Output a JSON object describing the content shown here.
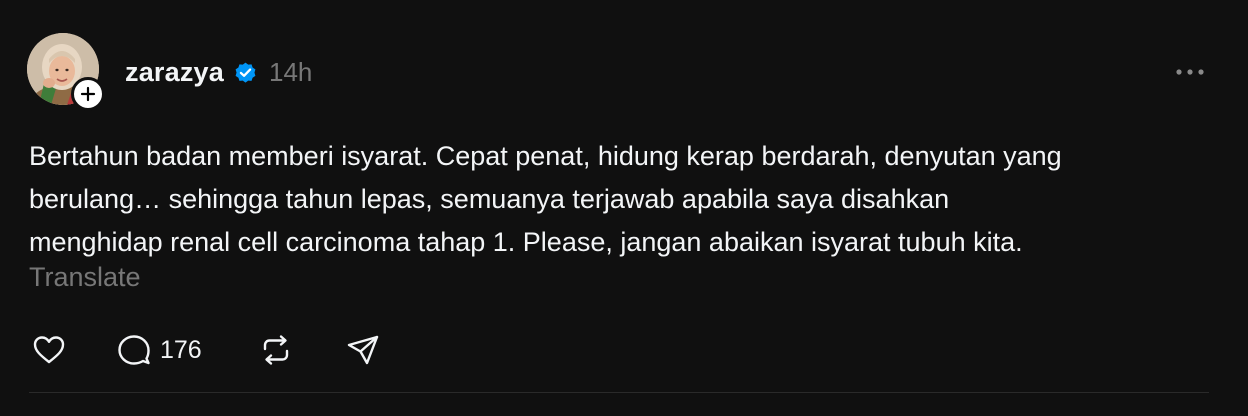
{
  "post": {
    "username": "zarazya",
    "verified": true,
    "timestamp": "14h",
    "body_lines": [
      "Bertahun badan memberi isyarat. Cepat penat, hidung kerap berdarah, denyutan yang",
      "berulang… sehingga tahun lepas, semuanya terjawab apabila saya disahkan",
      "menghidap renal cell carcinoma tahap 1. Please, jangan abaikan isyarat tubuh kita."
    ],
    "translate_label": "Translate",
    "reply_count": "176"
  },
  "icons": {
    "follow": "plus-icon",
    "verified": "verified-badge-icon",
    "more": "more-horizontal-icon",
    "like": "heart-icon",
    "reply": "comment-icon",
    "repost": "repost-icon",
    "share": "send-icon"
  },
  "colors": {
    "background": "#101010",
    "text_primary": "#f3f5f7",
    "text_secondary": "#777777",
    "verified_blue": "#0095f6"
  }
}
